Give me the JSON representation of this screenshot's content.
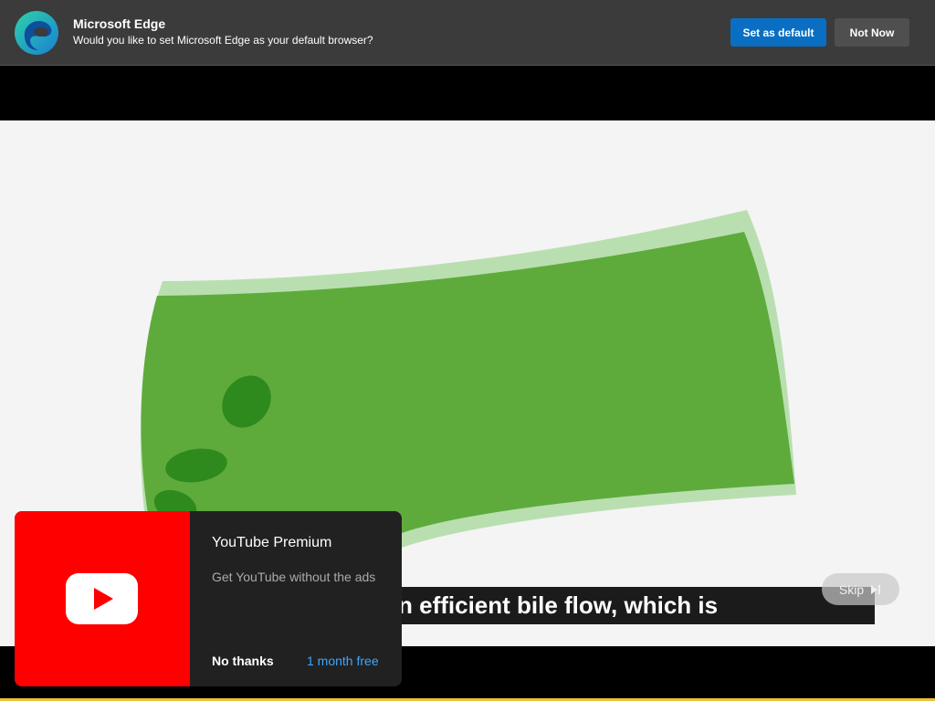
{
  "edge_banner": {
    "title": "Microsoft Edge",
    "message": "Would you like to set Microsoft Edge as your default browser?",
    "primary_button": "Set as default",
    "secondary_button": "Not Now",
    "logo_icon": "edge-logo-icon",
    "accent_color": "#0a6fc2"
  },
  "video": {
    "caption": "n efficient bile flow, which is",
    "skip_label": "Skip",
    "skip_icon": "skip-next-icon"
  },
  "premium_promo": {
    "title": "YouTube Premium",
    "subtitle": "Get YouTube without the ads",
    "dismiss_label": "No thanks",
    "trial_label": "1 month free",
    "logo_icon": "youtube-play-icon",
    "brand_color": "#ff0000",
    "link_color": "#3ea6ff"
  }
}
